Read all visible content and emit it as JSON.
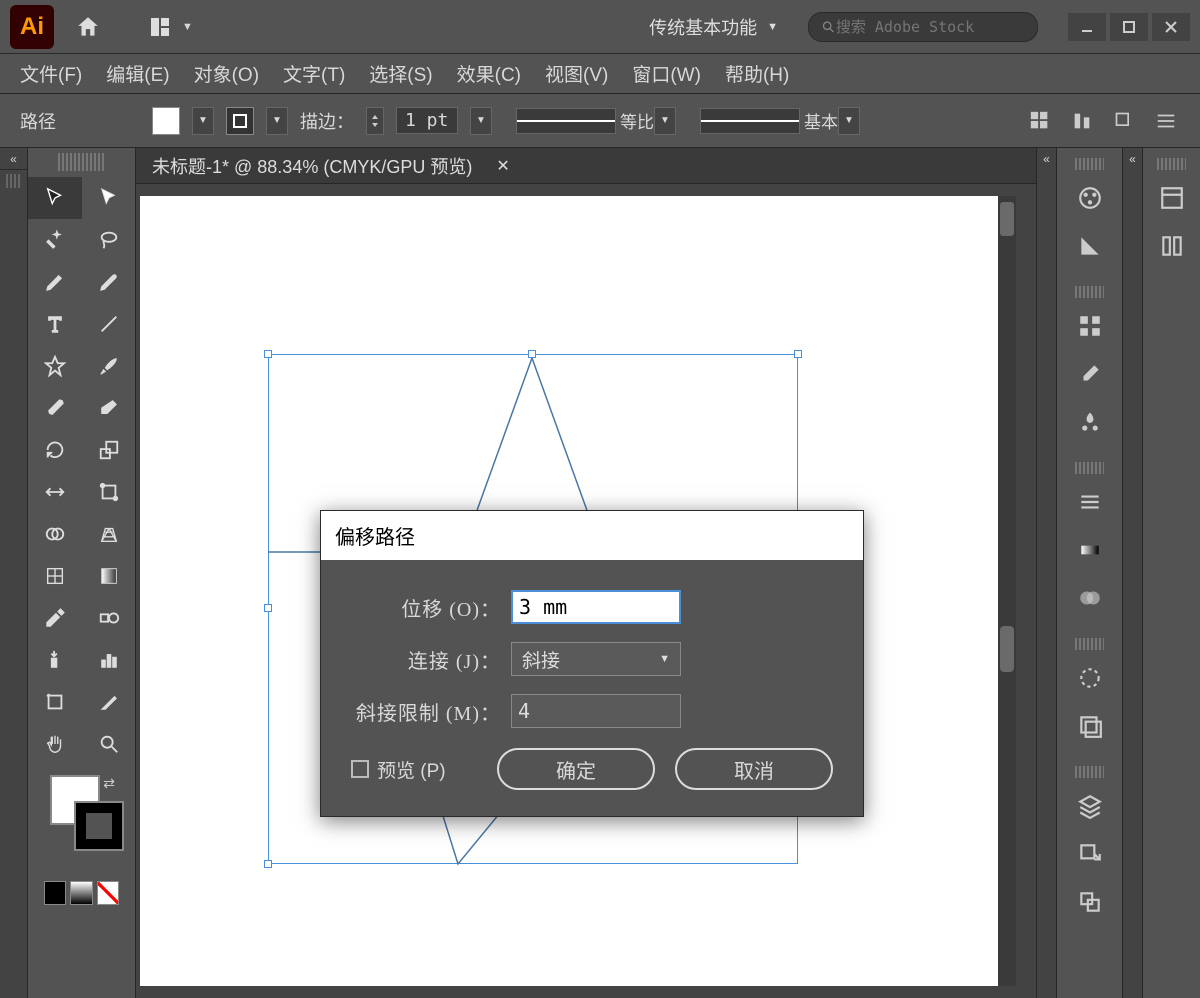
{
  "app": {
    "logo": "Ai"
  },
  "titlebar": {
    "workspace": "传统基本功能",
    "search_placeholder": "搜索 Adobe Stock"
  },
  "menu": {
    "file": "文件(F)",
    "edit": "编辑(E)",
    "object": "对象(O)",
    "type": "文字(T)",
    "select": "选择(S)",
    "effect": "效果(C)",
    "view": "视图(V)",
    "window": "窗口(W)",
    "help": "帮助(H)"
  },
  "control": {
    "label": "路径",
    "stroke_label": "描边：",
    "stroke_value": "1 pt",
    "profile_label": "等比",
    "brush_label": "基本"
  },
  "document": {
    "tab_title": "未标题-1* @ 88.34% (CMYK/GPU 预览)"
  },
  "dialog": {
    "title": "偏移路径",
    "offset_label": "位移 (O)：",
    "offset_value": "3 mm",
    "join_label": "连接 (J)：",
    "join_value": "斜接",
    "miter_label": "斜接限制 (M)：",
    "miter_value": "4",
    "preview_label": "预览 (P)",
    "ok": "确定",
    "cancel": "取消"
  }
}
